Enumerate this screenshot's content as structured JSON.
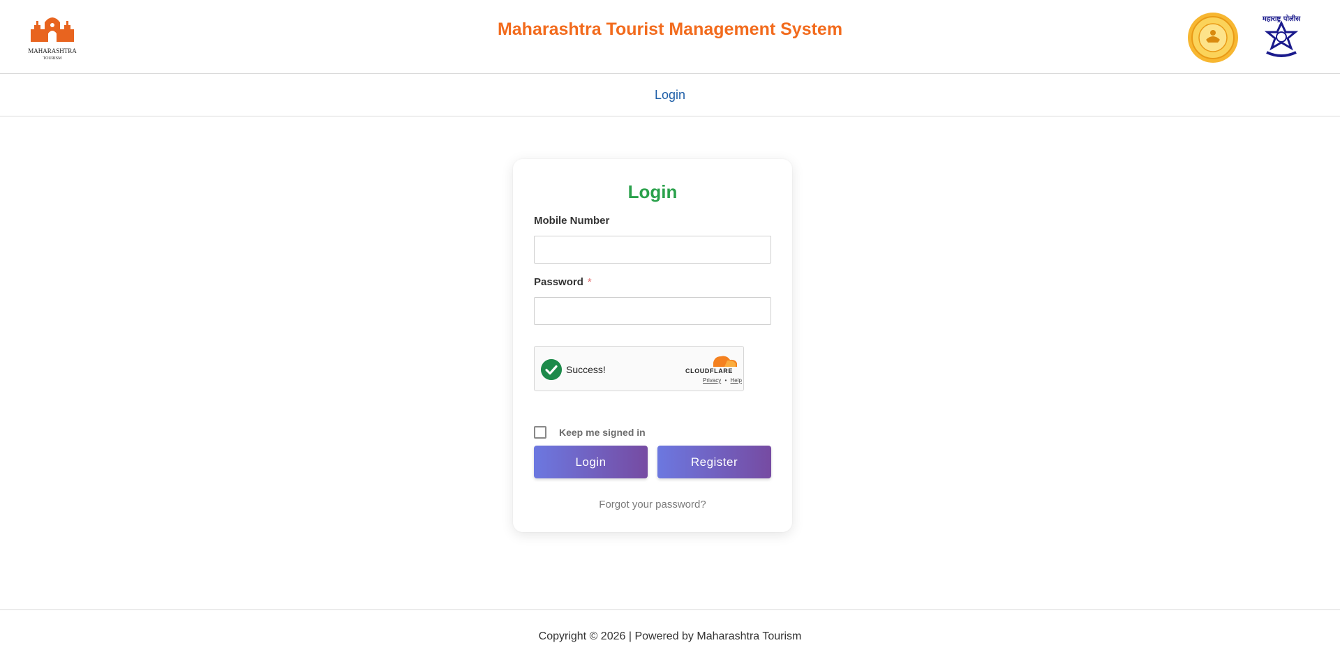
{
  "header": {
    "title": "Maharashtra Tourist Management System",
    "logo_left_name": "MAHARASHTRA",
    "logo_left_sub": "TOURISM",
    "emblem_right_text": "महाराष्ट्र पोलीस"
  },
  "nav": {
    "login": "Login"
  },
  "form": {
    "title": "Login",
    "mobile_label": "Mobile Number",
    "mobile_value": "",
    "password_label": "Password",
    "password_required_mark": "*",
    "password_value": "",
    "captcha": {
      "status": "Success!",
      "brand": "CLOUDFLARE",
      "privacy": "Privacy",
      "separator": "•",
      "help": "Help"
    },
    "keep_signed_in_label": "Keep me signed in",
    "keep_signed_in_checked": false,
    "login_button": "Login",
    "register_button": "Register",
    "forgot_link": "Forgot your password?"
  },
  "footer": {
    "text": "Copyright © 2026 | Powered by Maharashtra Tourism"
  },
  "colors": {
    "title_orange": "#f26b1d",
    "nav_blue": "#1f5fa8",
    "form_title_green": "#2aa14b",
    "button_gradient_start": "#6c78e0",
    "button_gradient_end": "#764ba2"
  }
}
